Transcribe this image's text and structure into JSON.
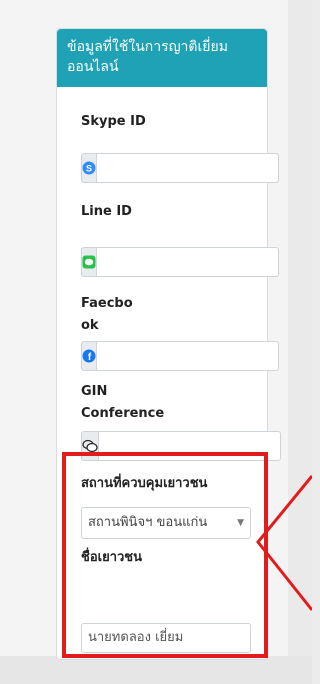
{
  "card": {
    "title": "ข้อมูลที่ใช้ในการญาติเยี่ยมออนไลน์"
  },
  "fields": {
    "skype": {
      "label": "Skype ID",
      "icon": "skype-icon",
      "value": ""
    },
    "line": {
      "label": "Line ID",
      "icon": "line-icon",
      "value": ""
    },
    "facebook": {
      "label": "Faecbook",
      "icon": "facebook-icon",
      "value": ""
    },
    "gin": {
      "label": "GIN Conference",
      "icon": "chat-bubbles-icon",
      "value": ""
    }
  },
  "detention_center": {
    "label": "สถานที่ควบคุมเยาวชน",
    "selected": "สถานพินิจฯ ขอนแก่น"
  },
  "youth_name": {
    "label": "ชื่อเยาวชน",
    "value": "นายทดลอง เยี่ยม"
  },
  "colors": {
    "header": "#1fa2b5",
    "highlight": "#e21c1c"
  }
}
